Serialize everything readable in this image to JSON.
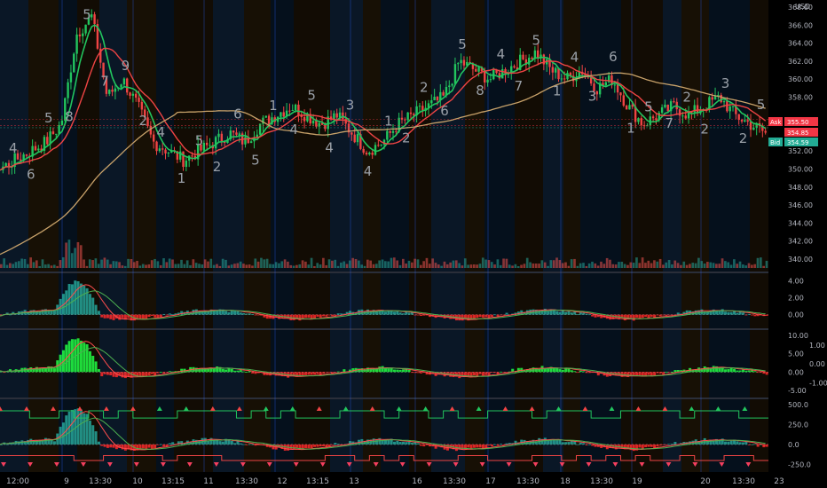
{
  "chart_data": {
    "type": "candlestick",
    "currency": "USD",
    "price_axis": {
      "ticks": [
        "368.00",
        "366.00",
        "364.00",
        "362.00",
        "360.00",
        "358.00",
        "354.00",
        "352.00",
        "350.00",
        "348.00",
        "346.00",
        "344.00",
        "342.00",
        "340.00"
      ],
      "range": [
        338.6,
        368.8
      ]
    },
    "x_labels": [
      "12:00",
      "9",
      "13:30",
      "10",
      "13:15",
      "11",
      "13:30",
      "12",
      "13:15",
      "13",
      "16",
      "13:30",
      "17",
      "13:30",
      "18",
      "13:30",
      "19",
      "20",
      "13:30",
      "23"
    ],
    "price_labels": [
      {
        "name": "Ask",
        "value": "355.50",
        "color": "#f23645"
      },
      {
        "name": "",
        "value": "354.85",
        "color": "#f23645"
      },
      {
        "name": "Bid",
        "value": "354.59",
        "color": "#22ab94"
      }
    ],
    "sequence_numbers": [
      "4",
      "6",
      "5",
      "8",
      "5",
      "7",
      "9",
      "2",
      "4",
      "1",
      "5",
      "2",
      "6",
      "5",
      "1",
      "4",
      "5",
      "4",
      "3",
      "4",
      "1",
      "2",
      "2",
      "6",
      "5",
      "8",
      "4",
      "7",
      "5",
      "1",
      "4",
      "3",
      "6",
      "1",
      "5",
      "7",
      "2",
      "2",
      "3",
      "2",
      "5"
    ],
    "price_path": [
      350,
      351,
      352,
      353,
      355,
      365,
      367,
      358,
      360,
      357,
      353,
      352,
      351,
      352,
      353,
      354,
      353,
      355,
      356,
      357,
      356,
      355,
      356,
      354,
      352,
      353,
      355,
      356,
      357,
      358,
      362,
      361,
      360,
      361,
      362,
      363,
      361,
      360,
      361,
      359,
      360,
      357,
      355,
      356,
      357,
      356,
      357,
      358,
      356,
      355,
      354
    ],
    "panels": [
      {
        "name": "oscillator-1",
        "ticks": [
          "4.00",
          "2.00",
          "0.00"
        ],
        "range": [
          -1.2,
          4.5
        ]
      },
      {
        "name": "oscillator-2",
        "ticks": [
          "10.00",
          "5.00",
          "0.00",
          "-5.00"
        ],
        "right_ticks": [
          "1.00",
          "0.00",
          "-1.00"
        ],
        "range": [
          -6,
          10.5
        ]
      },
      {
        "name": "oscillator-3",
        "ticks": [
          "500.0",
          "250.0",
          "0.0",
          "-250.0"
        ],
        "range": [
          -300,
          520
        ]
      }
    ]
  }
}
